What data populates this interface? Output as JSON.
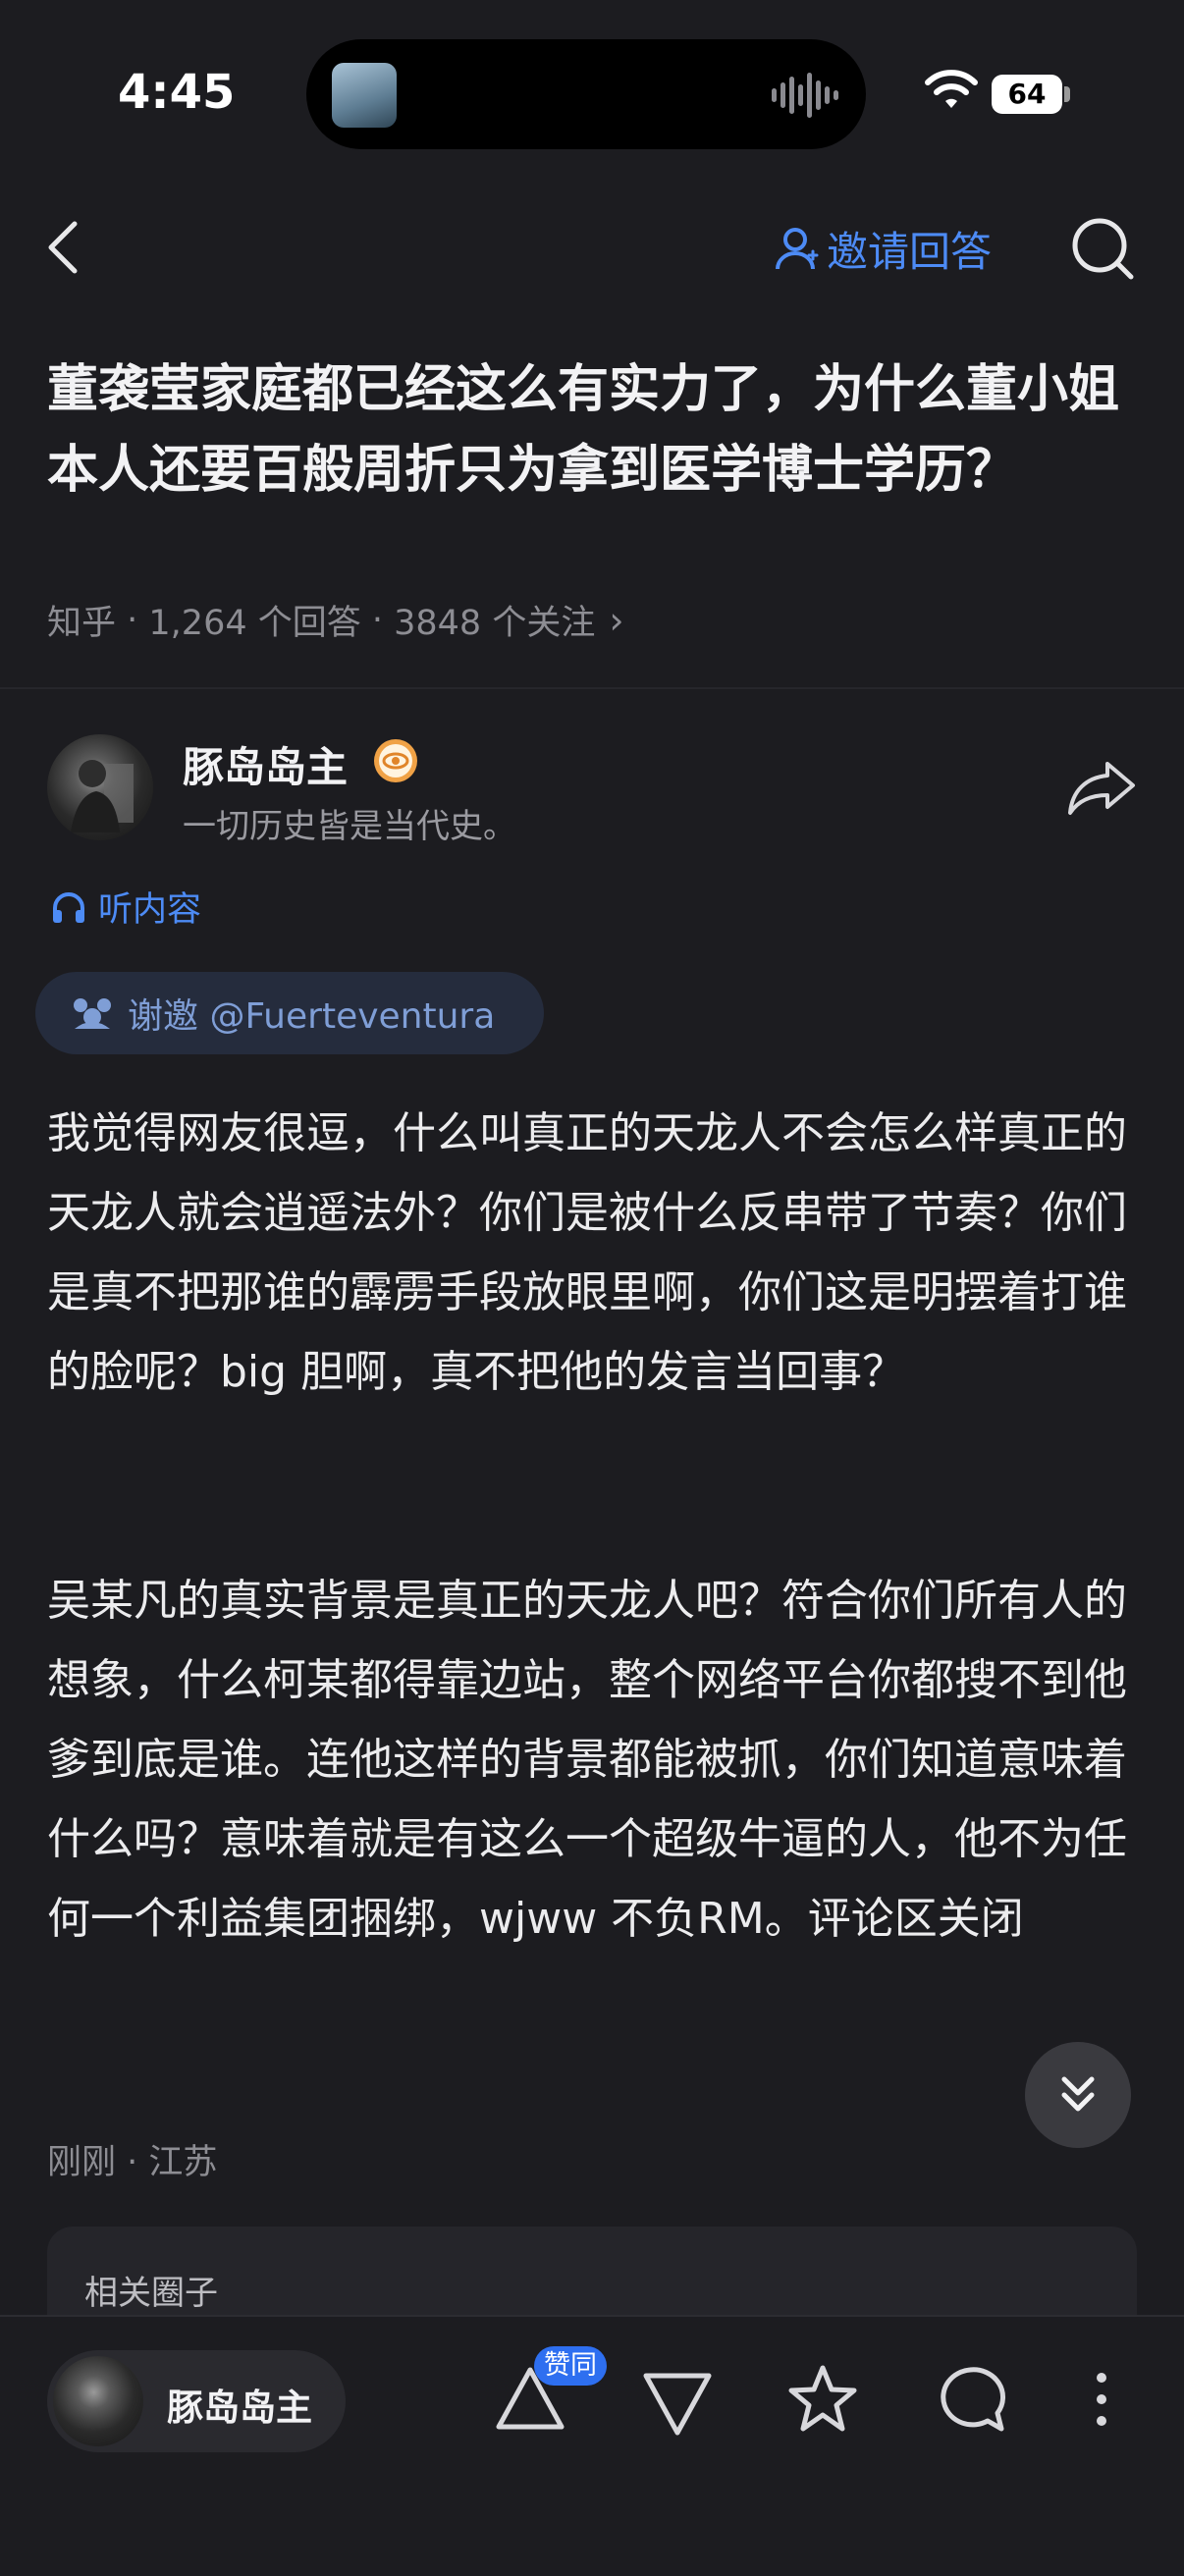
{
  "status_bar": {
    "time": "4:45",
    "battery": "64"
  },
  "nav": {
    "invite_label": "邀请回答"
  },
  "question": {
    "title": "董袭莹家庭都已经这么有实力了，为什么董小姐本人还要百般周折只为拿到医学博士学历？",
    "source": "知乎",
    "answers": "1,264 个回答",
    "followers": "3848 个关注",
    "separator": " · ",
    "chevron": "›"
  },
  "author": {
    "name": "豚岛岛主",
    "bio": "一切历史皆是当代史。"
  },
  "listen_label": "听内容",
  "thanks_chip": "谢邀 @Fuerteventura",
  "answer": {
    "paragraphs": [
      "我觉得网友很逗，什么叫真正的天龙人不会怎么样真正的天龙人就会逍遥法外？你们是被什么反串带了节奏？你们是真不把那谁的霹雳手段放眼里啊，你们这是明摆着打谁的脸呢？big 胆啊，真不把他的发言当回事？",
      "吴某凡的真实背景是真正的天龙人吧？符合你们所有人的想象，什么柯某都得靠边站，整个网络平台你都搜不到他爹到底是谁。连他这样的背景都能被抓，你们知道意味着什么吗？意味着就是有这么一个超级牛逼的人，他不为任何一个利益集团捆绑，wjww 不负RM。评论区关闭"
    ],
    "meta": "刚刚 · 江苏"
  },
  "related": {
    "label": "相关圈子"
  },
  "bottom_bar": {
    "author_name": "豚岛岛主",
    "upvote_badge": "赞同"
  },
  "colors": {
    "accent": "#4d8bf5",
    "background": "#1c1c20",
    "badge": "#2e6ff0"
  },
  "icons": [
    "back-icon",
    "user-icon",
    "search-icon",
    "share-icon",
    "headphones-icon",
    "thanks-icon",
    "collapse-icon",
    "upvote-icon",
    "downvote-icon",
    "star-icon",
    "comment-icon",
    "more-icon"
  ]
}
